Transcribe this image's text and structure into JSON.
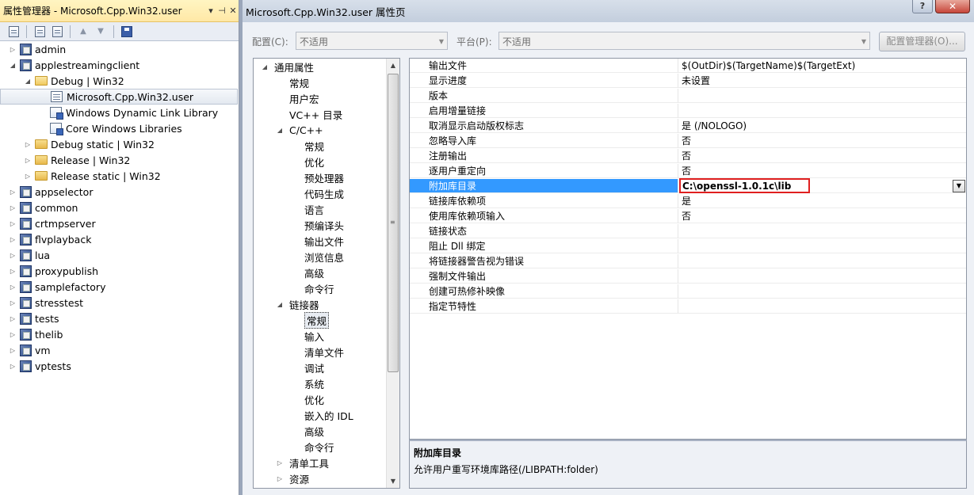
{
  "left_panel": {
    "title": "属性管理器 - Microsoft.Cpp.Win32.user",
    "title_buttons": [
      "▾",
      "⊣",
      "✕"
    ],
    "tree": [
      {
        "level": 0,
        "expander": "▷",
        "icon": "project",
        "label": "admin"
      },
      {
        "level": 0,
        "expander": "◢",
        "icon": "project",
        "label": "applestreamingclient"
      },
      {
        "level": 1,
        "expander": "◢",
        "icon": "folder-open",
        "label": "Debug | Win32"
      },
      {
        "level": 2,
        "expander": "",
        "icon": "sheet",
        "label": "Microsoft.Cpp.Win32.user",
        "selected": true
      },
      {
        "level": 2,
        "expander": "",
        "icon": "sheet2",
        "label": "Windows Dynamic Link Library"
      },
      {
        "level": 2,
        "expander": "",
        "icon": "sheet2",
        "label": "Core Windows Libraries"
      },
      {
        "level": 1,
        "expander": "▷",
        "icon": "folder",
        "label": "Debug static | Win32"
      },
      {
        "level": 1,
        "expander": "▷",
        "icon": "folder",
        "label": "Release | Win32"
      },
      {
        "level": 1,
        "expander": "▷",
        "icon": "folder",
        "label": "Release static | Win32"
      },
      {
        "level": 0,
        "expander": "▷",
        "icon": "project",
        "label": "appselector"
      },
      {
        "level": 0,
        "expander": "▷",
        "icon": "project",
        "label": "common"
      },
      {
        "level": 0,
        "expander": "▷",
        "icon": "project",
        "label": "crtmpserver"
      },
      {
        "level": 0,
        "expander": "▷",
        "icon": "project",
        "label": "flvplayback"
      },
      {
        "level": 0,
        "expander": "▷",
        "icon": "project",
        "label": "lua"
      },
      {
        "level": 0,
        "expander": "▷",
        "icon": "project",
        "label": "proxypublish"
      },
      {
        "level": 0,
        "expander": "▷",
        "icon": "project",
        "label": "samplefactory"
      },
      {
        "level": 0,
        "expander": "▷",
        "icon": "project",
        "label": "stresstest"
      },
      {
        "level": 0,
        "expander": "▷",
        "icon": "project",
        "label": "tests"
      },
      {
        "level": 0,
        "expander": "▷",
        "icon": "project",
        "label": "thelib"
      },
      {
        "level": 0,
        "expander": "▷",
        "icon": "project",
        "label": "vm"
      },
      {
        "level": 0,
        "expander": "▷",
        "icon": "project",
        "label": "vptests"
      }
    ]
  },
  "dialog": {
    "title": "Microsoft.Cpp.Win32.user 属性页",
    "help_label": "?",
    "close_label": "✕",
    "config_label": "配置(C):",
    "config_value": "不适用",
    "platform_label": "平台(P):",
    "platform_value": "不适用",
    "config_manager_label": "配置管理器(O)...",
    "nav": [
      {
        "level": 0,
        "expander": "◢",
        "label": "通用属性"
      },
      {
        "level": 1,
        "expander": "",
        "label": "常规"
      },
      {
        "level": 1,
        "expander": "",
        "label": "用户宏"
      },
      {
        "level": 1,
        "expander": "",
        "label": "VC++ 目录"
      },
      {
        "level": 1,
        "expander": "◢",
        "label": "C/C++"
      },
      {
        "level": 2,
        "expander": "",
        "label": "常规"
      },
      {
        "level": 2,
        "expander": "",
        "label": "优化"
      },
      {
        "level": 2,
        "expander": "",
        "label": "预处理器"
      },
      {
        "level": 2,
        "expander": "",
        "label": "代码生成"
      },
      {
        "level": 2,
        "expander": "",
        "label": "语言"
      },
      {
        "level": 2,
        "expander": "",
        "label": "预编译头"
      },
      {
        "level": 2,
        "expander": "",
        "label": "输出文件"
      },
      {
        "level": 2,
        "expander": "",
        "label": "浏览信息"
      },
      {
        "level": 2,
        "expander": "",
        "label": "高级"
      },
      {
        "level": 2,
        "expander": "",
        "label": "命令行"
      },
      {
        "level": 1,
        "expander": "◢",
        "label": "链接器"
      },
      {
        "level": 2,
        "expander": "",
        "label": "常规",
        "selected": true
      },
      {
        "level": 2,
        "expander": "",
        "label": "输入"
      },
      {
        "level": 2,
        "expander": "",
        "label": "清单文件"
      },
      {
        "level": 2,
        "expander": "",
        "label": "调试"
      },
      {
        "level": 2,
        "expander": "",
        "label": "系统"
      },
      {
        "level": 2,
        "expander": "",
        "label": "优化"
      },
      {
        "level": 2,
        "expander": "",
        "label": "嵌入的 IDL"
      },
      {
        "level": 2,
        "expander": "",
        "label": "高级"
      },
      {
        "level": 2,
        "expander": "",
        "label": "命令行"
      },
      {
        "level": 1,
        "expander": "▷",
        "label": "清单工具"
      },
      {
        "level": 1,
        "expander": "▷",
        "label": "资源"
      }
    ],
    "properties": [
      {
        "name": "输出文件",
        "value": "$(OutDir)$(TargetName)$(TargetExt)"
      },
      {
        "name": "显示进度",
        "value": "未设置"
      },
      {
        "name": "版本",
        "value": ""
      },
      {
        "name": "启用增量链接",
        "value": ""
      },
      {
        "name": "取消显示启动版权标志",
        "value": "是 (/NOLOGO)"
      },
      {
        "name": "忽略导入库",
        "value": "否"
      },
      {
        "name": "注册输出",
        "value": "否"
      },
      {
        "name": "逐用户重定向",
        "value": "否"
      },
      {
        "name": "附加库目录",
        "value": "C:\\openssl-1.0.1c\\lib",
        "selected": true
      },
      {
        "name": "链接库依赖项",
        "value": "是"
      },
      {
        "name": "使用库依赖项输入",
        "value": "否"
      },
      {
        "name": "链接状态",
        "value": ""
      },
      {
        "name": "阻止 Dll 绑定",
        "value": ""
      },
      {
        "name": "将链接器警告视为错误",
        "value": ""
      },
      {
        "name": "强制文件输出",
        "value": ""
      },
      {
        "name": "创建可热修补映像",
        "value": ""
      },
      {
        "name": "指定节特性",
        "value": ""
      }
    ],
    "description": {
      "title": "附加库目录",
      "text": "允许用户重写环境库路径(/LIBPATH:folder)"
    }
  }
}
